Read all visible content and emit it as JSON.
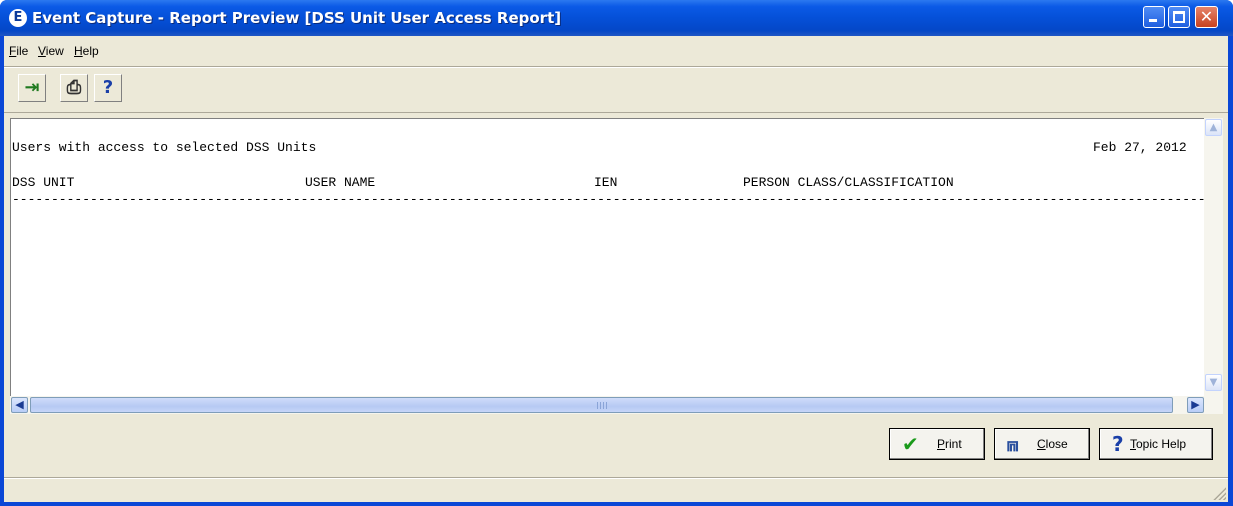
{
  "window": {
    "title": "Event Capture - Report Preview [DSS Unit User Access Report]",
    "app_icon": "E"
  },
  "menu": {
    "items": [
      {
        "label": "File",
        "accel": "F"
      },
      {
        "label": "View",
        "accel": "V"
      },
      {
        "label": "Help",
        "accel": "H"
      }
    ]
  },
  "toolbar": {
    "buttons": [
      {
        "icon": "exit-door-icon",
        "glyph": "⇥"
      },
      {
        "icon": "printer-icon",
        "glyph": "⎙"
      },
      {
        "icon": "help-question-icon",
        "glyph": "?"
      }
    ]
  },
  "report": {
    "heading": "Users with access to selected DSS Units",
    "date": "Feb 27, 2012",
    "columns": [
      "DSS UNIT",
      "USER NAME",
      "IEN",
      "PERSON CLASS/CLASSIFICATION"
    ],
    "divider": "-------------------------------------------------------------------------------------------------------------------------------------------------------------------------------"
  },
  "buttons": {
    "print": {
      "label": "Print",
      "accel": "P",
      "icon": "checkmark-icon"
    },
    "close": {
      "label": "Close",
      "accel": "C",
      "icon": "door-exit-icon"
    },
    "topic_help": {
      "label": "Topic Help",
      "accel": "T",
      "icon": "help-question-icon"
    }
  },
  "colors": {
    "titlebar": "#0550d8",
    "face": "#ece9d8",
    "print_check": "#1a9a1a",
    "help_mark": "#1a3fa8"
  }
}
